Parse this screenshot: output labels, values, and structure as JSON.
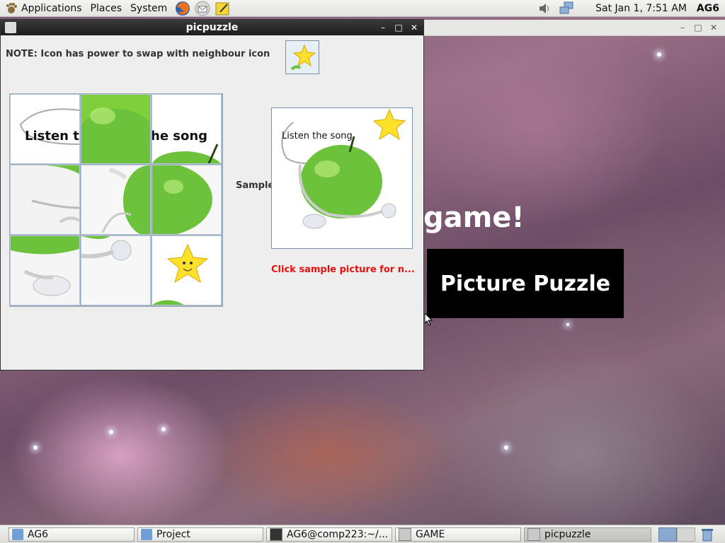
{
  "top_panel": {
    "menus": [
      "Applications",
      "Places",
      "System"
    ],
    "clock": "Sat Jan  1,  7:51 AM",
    "user": "AG6",
    "icons": [
      "foot-logo-icon",
      "firefox-icon",
      "mail-icon",
      "notes-icon",
      "volume-icon",
      "network-icon"
    ]
  },
  "desktop": {
    "heading": "game!",
    "banner": "Picture Puzzle"
  },
  "app": {
    "title": "picpuzzle",
    "note": "NOTE: Icon has power to swap with neighbour icon",
    "sample_label": "Sample",
    "sample_hint": "Click sample picture for n...",
    "tile_text": {
      "listen_left": "Listen th",
      "song_right": "he song"
    },
    "sample_text": "Listen the song"
  },
  "taskbar": {
    "items": [
      "AG6",
      "Project",
      "AG6@comp223:~/...",
      "GAME",
      "picpuzzle"
    ]
  },
  "colors": {
    "accent_red": "#e8100c",
    "apple_green": "#6cc23a",
    "star_yellow": "#ffe12b"
  }
}
